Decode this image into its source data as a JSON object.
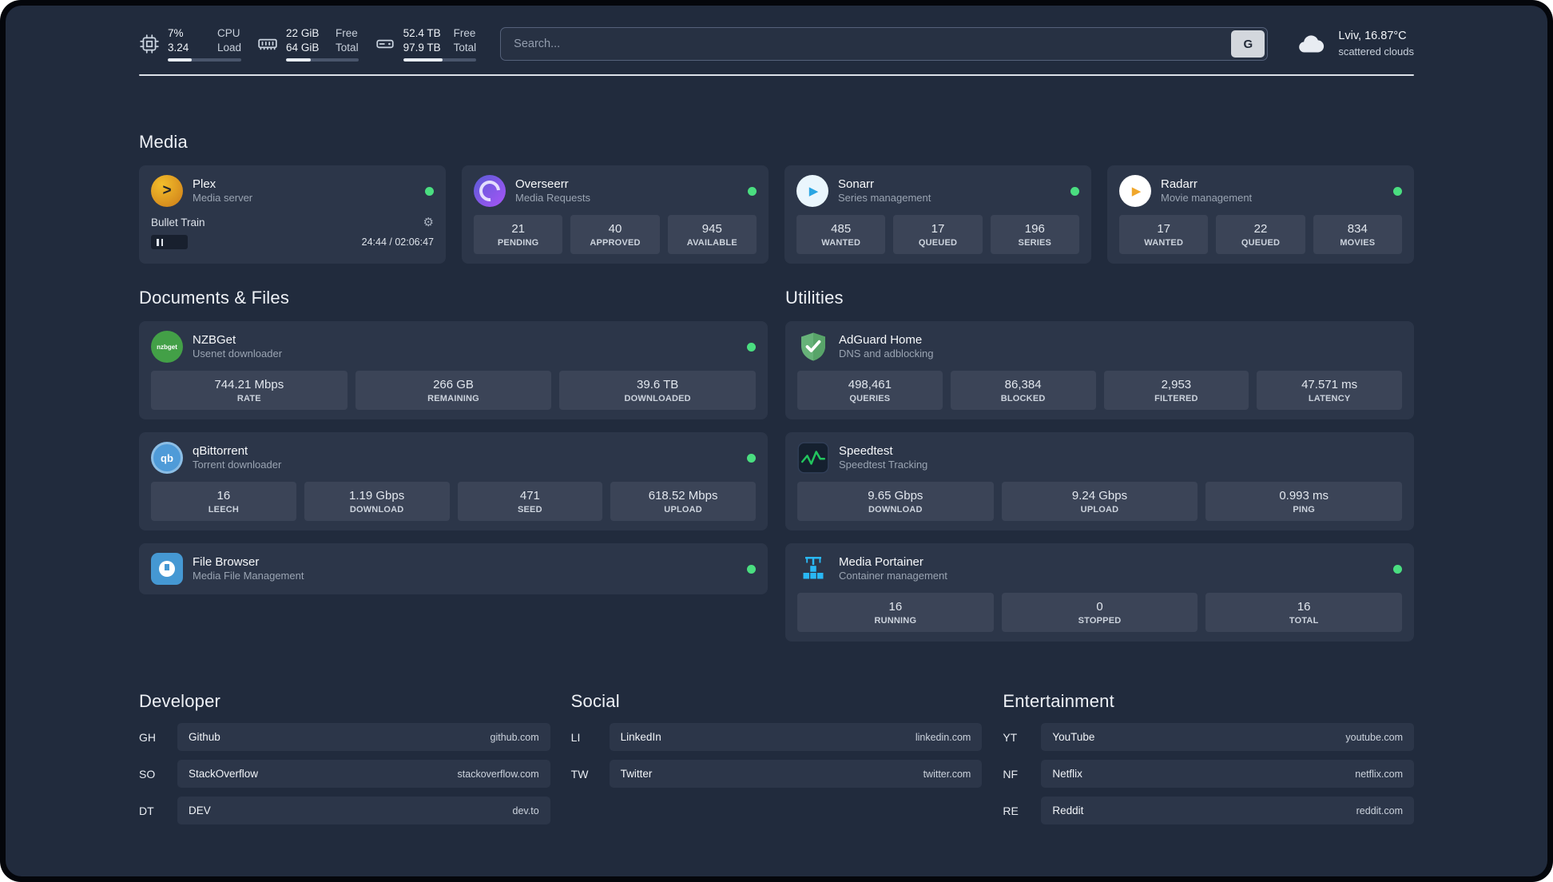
{
  "colors": {
    "status_online": "#4ade80",
    "accent_green": "#22c55e",
    "background": "#212b3d",
    "card": "#2c3649"
  },
  "topbar": {
    "cpu": {
      "icon": "cpu-chip-icon",
      "value_primary": "7%",
      "value_secondary": "3.24",
      "label_primary": "CPU",
      "label_secondary": "Load",
      "progress_pct": 33
    },
    "memory": {
      "icon": "memory-icon",
      "value_primary": "22 GiB",
      "value_secondary": "64 GiB",
      "label_primary": "Free",
      "label_secondary": "Total",
      "progress_pct": 34
    },
    "disk": {
      "icon": "disk-icon",
      "value_primary": "52.4 TB",
      "value_secondary": "97.9 TB",
      "label_primary": "Free",
      "label_secondary": "Total",
      "progress_pct": 54
    },
    "search": {
      "placeholder": "Search...",
      "provider_button": "G"
    },
    "weather": {
      "icon": "cloud-icon",
      "location": "Lviv, 16.87°C",
      "condition": "scattered clouds"
    }
  },
  "media": {
    "title": "Media",
    "plex": {
      "icon": "plex-icon",
      "name": "Plex",
      "subtitle": "Media server",
      "now_playing": "Bullet Train",
      "time": "24:44 / 02:06:47"
    },
    "overseerr": {
      "icon": "overseerr-icon",
      "name": "Overseerr",
      "subtitle": "Media Requests",
      "stats": [
        {
          "value": "21",
          "label": "PENDING"
        },
        {
          "value": "40",
          "label": "APPROVED"
        },
        {
          "value": "945",
          "label": "AVAILABLE"
        }
      ]
    },
    "sonarr": {
      "icon": "sonarr-icon",
      "name": "Sonarr",
      "subtitle": "Series management",
      "stats": [
        {
          "value": "485",
          "label": "WANTED"
        },
        {
          "value": "17",
          "label": "QUEUED"
        },
        {
          "value": "196",
          "label": "SERIES"
        }
      ]
    },
    "radarr": {
      "icon": "radarr-icon",
      "name": "Radarr",
      "subtitle": "Movie management",
      "stats": [
        {
          "value": "17",
          "label": "WANTED"
        },
        {
          "value": "22",
          "label": "QUEUED"
        },
        {
          "value": "834",
          "label": "MOVIES"
        }
      ]
    }
  },
  "documents": {
    "title": "Documents & Files",
    "nzbget": {
      "icon": "nzbget-icon",
      "icon_text": "nzbget",
      "name": "NZBGet",
      "subtitle": "Usenet downloader",
      "stats": [
        {
          "value": "744.21 Mbps",
          "label": "RATE"
        },
        {
          "value": "266 GB",
          "label": "REMAINING"
        },
        {
          "value": "39.6 TB",
          "label": "DOWNLOADED"
        }
      ]
    },
    "qbittorrent": {
      "icon": "qbittorrent-icon",
      "icon_text": "qb",
      "name": "qBittorrent",
      "subtitle": "Torrent downloader",
      "stats": [
        {
          "value": "16",
          "label": "LEECH"
        },
        {
          "value": "1.19 Gbps",
          "label": "DOWNLOAD"
        },
        {
          "value": "471",
          "label": "SEED"
        },
        {
          "value": "618.52 Mbps",
          "label": "UPLOAD"
        }
      ]
    },
    "filebrowser": {
      "icon": "filebrowser-icon",
      "name": "File Browser",
      "subtitle": "Media File Management"
    }
  },
  "utilities": {
    "title": "Utilities",
    "adguard": {
      "icon": "adguard-shield-icon",
      "name": "AdGuard Home",
      "subtitle": "DNS and adblocking",
      "stats": [
        {
          "value": "498,461",
          "label": "QUERIES"
        },
        {
          "value": "86,384",
          "label": "BLOCKED"
        },
        {
          "value": "2,953",
          "label": "FILTERED"
        },
        {
          "value": "47.571 ms",
          "label": "LATENCY"
        }
      ]
    },
    "speedtest": {
      "icon": "speedtest-graph-icon",
      "name": "Speedtest",
      "subtitle": "Speedtest Tracking",
      "stats": [
        {
          "value": "9.65 Gbps",
          "label": "DOWNLOAD"
        },
        {
          "value": "9.24 Gbps",
          "label": "UPLOAD"
        },
        {
          "value": "0.993 ms",
          "label": "PING"
        }
      ]
    },
    "portainer": {
      "icon": "portainer-crane-icon",
      "name": "Media Portainer",
      "subtitle": "Container management",
      "stats": [
        {
          "value": "16",
          "label": "RUNNING"
        },
        {
          "value": "0",
          "label": "STOPPED"
        },
        {
          "value": "16",
          "label": "TOTAL"
        }
      ]
    }
  },
  "bookmarks": [
    {
      "title": "Developer",
      "items": [
        {
          "abbr": "GH",
          "name": "Github",
          "url": "github.com"
        },
        {
          "abbr": "SO",
          "name": "StackOverflow",
          "url": "stackoverflow.com"
        },
        {
          "abbr": "DT",
          "name": "DEV",
          "url": "dev.to"
        }
      ]
    },
    {
      "title": "Social",
      "items": [
        {
          "abbr": "LI",
          "name": "LinkedIn",
          "url": "linkedin.com"
        },
        {
          "abbr": "TW",
          "name": "Twitter",
          "url": "twitter.com"
        }
      ]
    },
    {
      "title": "Entertainment",
      "items": [
        {
          "abbr": "YT",
          "name": "YouTube",
          "url": "youtube.com"
        },
        {
          "abbr": "NF",
          "name": "Netflix",
          "url": "netflix.com"
        },
        {
          "abbr": "RE",
          "name": "Reddit",
          "url": "reddit.com"
        }
      ]
    }
  ]
}
